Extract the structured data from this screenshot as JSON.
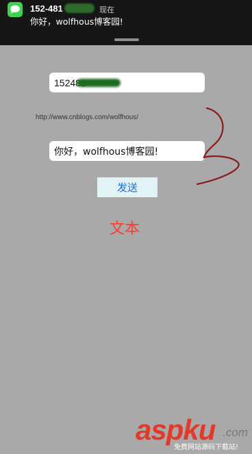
{
  "notification": {
    "app_icon": "messages-icon",
    "sender": "152-481",
    "time": "现在",
    "preview": "你好，wolfhous博客园!"
  },
  "form": {
    "phone_value": "152481",
    "url_text": "http://www.cnblogs.com/wolfhous/",
    "message_value": "你好，wolfhous博客园!",
    "send_label": "发送",
    "text_label": "文本"
  },
  "watermark": {
    "main": "aspku",
    "sub": ".com",
    "caption": "免费网站源码下载站!"
  },
  "colors": {
    "background": "#a9a9a9",
    "banner": "#161616",
    "send_text": "#1a6fe0",
    "text_label": "#ff3b30",
    "annotation": "#8b1a1a"
  }
}
